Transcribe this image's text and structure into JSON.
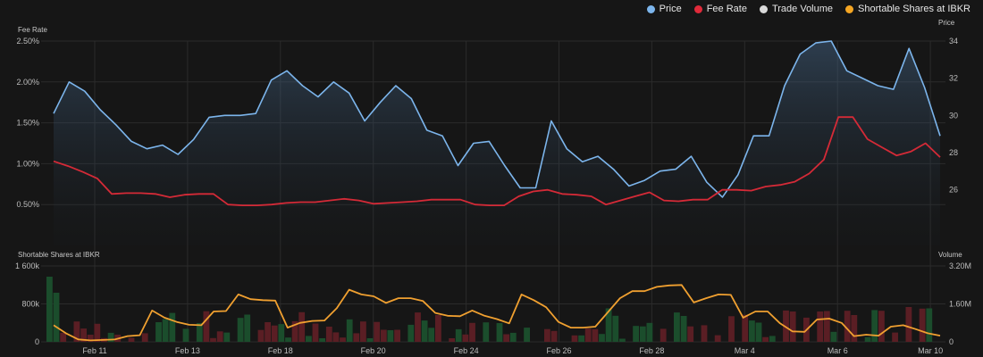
{
  "legend": [
    {
      "label": "Price",
      "color": "#7cb5ec",
      "icon": "circle-icon"
    },
    {
      "label": "Fee Rate",
      "color": "#e02a3a",
      "icon": "circle-icon"
    },
    {
      "label": "Trade Volume",
      "color": "#d9d9d9",
      "icon": "circle-icon"
    },
    {
      "label": "Shortable Shares at IBKR",
      "color": "#f5a623",
      "icon": "circle-icon"
    }
  ],
  "colors": {
    "price": "#7cb5ec",
    "fee": "#d42a37",
    "shortable": "#f0a030",
    "volume_up": "#1b4d2c",
    "volume_down": "#5a1e24",
    "grid": "#2b2b2b"
  },
  "chart_data": [
    {
      "type": "line",
      "title": "",
      "x_tick_labels": [
        "Feb 11",
        "Feb 13",
        "Feb 18",
        "Feb 20",
        "Feb 24",
        "Feb 26",
        "Feb 28",
        "Mar 4",
        "Mar 6",
        "Mar 10"
      ],
      "y_left_label": "Fee Rate",
      "y_left_ticks": [
        "0.50%",
        "1.00%",
        "1.50%",
        "2.00%",
        "2.50%"
      ],
      "y_left_range": [
        0.0,
        2.5
      ],
      "y_right_label": "Price",
      "y_right_ticks": [
        "26",
        "28",
        "30",
        "32",
        "34"
      ],
      "y_right_range": [
        23.0,
        34.0
      ],
      "price_area_fill": true,
      "grid": true,
      "legend_position": "top-right",
      "series": [
        {
          "name": "Price",
          "axis": "right",
          "values": [
            30.1,
            31.8,
            31.3,
            30.3,
            29.5,
            28.6,
            28.2,
            28.4,
            27.9,
            28.7,
            29.9,
            30.0,
            30.0,
            30.1,
            31.9,
            32.4,
            31.6,
            31.0,
            31.8,
            31.2,
            29.7,
            30.7,
            31.6,
            30.9,
            29.2,
            28.9,
            27.3,
            28.5,
            28.6,
            27.3,
            26.1,
            26.1,
            29.7,
            28.2,
            27.5,
            27.8,
            27.1,
            26.2,
            26.5,
            27.0,
            27.1,
            27.8,
            26.4,
            25.6,
            26.8,
            28.9,
            28.9,
            31.6,
            33.3,
            33.9,
            34.0,
            32.4,
            32.0,
            31.6,
            31.4,
            33.6,
            31.5,
            28.9
          ]
        },
        {
          "name": "Fee Rate",
          "axis": "left",
          "values": [
            1.03,
            0.97,
            0.9,
            0.82,
            0.63,
            0.64,
            0.64,
            0.63,
            0.59,
            0.62,
            0.63,
            0.63,
            0.5,
            0.49,
            0.49,
            0.5,
            0.52,
            0.53,
            0.53,
            0.55,
            0.57,
            0.55,
            0.51,
            0.52,
            0.53,
            0.54,
            0.56,
            0.56,
            0.56,
            0.5,
            0.49,
            0.49,
            0.6,
            0.66,
            0.68,
            0.63,
            0.62,
            0.6,
            0.5,
            0.55,
            0.6,
            0.65,
            0.55,
            0.54,
            0.56,
            0.56,
            0.68,
            0.68,
            0.67,
            0.72,
            0.74,
            0.78,
            0.88,
            1.05,
            1.57,
            1.57,
            1.3,
            1.2,
            1.1,
            1.15,
            1.25,
            1.08
          ]
        }
      ]
    },
    {
      "type": "bar",
      "title": "",
      "x_tick_labels": [
        "Feb 11",
        "Feb 13",
        "Feb 18",
        "Feb 20",
        "Feb 24",
        "Feb 26",
        "Feb 28",
        "Mar 4",
        "Mar 6",
        "Mar 10"
      ],
      "y_left_label": "Shortable Shares at IBKR",
      "y_left_ticks": [
        "0",
        "800k",
        "1 600k"
      ],
      "y_left_range": [
        0,
        1600000
      ],
      "y_right_label": "Volume",
      "y_right_ticks": [
        "0",
        "1.60M",
        "3.20M"
      ],
      "y_right_range": [
        0,
        3200000
      ],
      "series": [
        {
          "name": "Shortable Shares at IBKR",
          "type": "line",
          "axis": "left",
          "values": [
            350000,
            180000,
            50000,
            30000,
            40000,
            50000,
            120000,
            140000,
            660000,
            510000,
            420000,
            360000,
            350000,
            640000,
            650000,
            1000000,
            900000,
            880000,
            870000,
            300000,
            400000,
            440000,
            450000,
            710000,
            1100000,
            1000000,
            960000,
            820000,
            920000,
            920000,
            860000,
            610000,
            550000,
            540000,
            660000,
            550000,
            480000,
            390000,
            1000000,
            880000,
            730000,
            420000,
            300000,
            300000,
            320000,
            620000,
            920000,
            1070000,
            1070000,
            1160000,
            1190000,
            1200000,
            830000,
            920000,
            1000000,
            990000,
            510000,
            640000,
            640000,
            390000,
            220000,
            210000,
            470000,
            490000,
            400000,
            120000,
            150000,
            130000,
            320000,
            350000,
            270000,
            180000,
            130000
          ]
        },
        {
          "name": "Trade Volume",
          "type": "bar",
          "axis": "right",
          "values": [
            2750000,
            2070000,
            380000,
            0,
            860000,
            560000,
            300000,
            760000,
            160000,
            380000,
            300000,
            0,
            170000,
            0,
            360000,
            0,
            830000,
            960000,
            1220000,
            0,
            550000,
            0,
            790000,
            1290000,
            160000,
            440000,
            390000,
            0,
            1010000,
            1150000,
            0,
            500000,
            830000,
            690000,
            750000,
            180000,
            870000,
            1250000,
            250000,
            770000,
            150000,
            640000,
            400000,
            180000,
            950000,
            360000,
            860000,
            150000,
            840000,
            510000,
            490000,
            510000,
            0,
            720000,
            1240000,
            900000,
            590000,
            1130000,
            0,
            150000,
            530000,
            310000,
            800000,
            0,
            820000,
            0,
            790000,
            320000,
            380000,
            0,
            600000,
            0,
            0,
            540000,
            460000,
            0,
            0,
            270000,
            270000,
            560000,
            540000,
            330000,
            1410000,
            1100000,
            130000,
            0,
            670000,
            650000,
            800000,
            0,
            550000,
            0,
            1240000,
            1090000,
            650000,
            0,
            700000,
            0,
            280000,
            0,
            1080000,
            0,
            1140000,
            900000,
            810000,
            200000,
            250000,
            0,
            1320000,
            1280000,
            0,
            1020000,
            0,
            1280000,
            1300000,
            420000,
            0,
            1310000,
            1130000,
            0,
            200000,
            1340000,
            1310000,
            0,
            390000,
            0,
            1470000,
            0,
            1400000,
            1410000
          ],
          "colors": [
            "up",
            "up",
            "down",
            "up",
            "down",
            "down",
            "down",
            "down",
            "down",
            "up",
            "down",
            "up",
            "down",
            "up",
            "down",
            "up",
            "up",
            "up",
            "up",
            "up",
            "up",
            "up",
            "up",
            "down",
            "down",
            "down",
            "up",
            "down",
            "up",
            "up",
            "down",
            "down",
            "down",
            "down",
            "up",
            "up",
            "down",
            "down",
            "up",
            "down",
            "up",
            "down",
            "down",
            "down",
            "up",
            "down",
            "down",
            "up",
            "down",
            "down",
            "up",
            "down",
            "down",
            "up",
            "down",
            "up",
            "up",
            "down",
            "up",
            "down",
            "up",
            "down",
            "down",
            "down",
            "up",
            "down",
            "up",
            "down",
            "up",
            "up",
            "up",
            "up",
            "up",
            "down",
            "down",
            "up",
            "down",
            "down",
            "up",
            "down",
            "down",
            "up",
            "up",
            "up",
            "up",
            "down",
            "up",
            "up",
            "up",
            "down",
            "down",
            "down",
            "up",
            "up",
            "down",
            "down",
            "down",
            "up",
            "down",
            "down",
            "down",
            "up",
            "down",
            "up",
            "up",
            "down",
            "up",
            "up",
            "down",
            "down",
            "up",
            "down",
            "down",
            "down",
            "down",
            "up",
            "up",
            "down",
            "down",
            "down"
          ]
        }
      ]
    }
  ]
}
